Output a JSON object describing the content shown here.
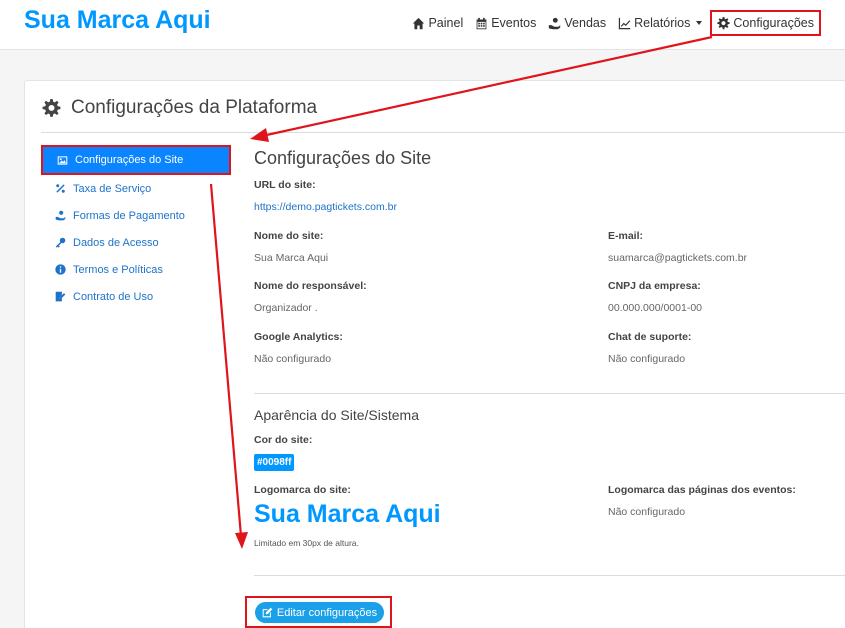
{
  "brand": "Sua Marca Aqui",
  "nav": {
    "items": [
      {
        "label": "Painel",
        "icon": "home-icon"
      },
      {
        "label": "Eventos",
        "icon": "calendar-icon"
      },
      {
        "label": "Vendas",
        "icon": "hand-money-icon"
      },
      {
        "label": "Relatórios",
        "icon": "line-chart-icon"
      },
      {
        "label": "Configurações",
        "icon": "gear-icon"
      }
    ]
  },
  "page": {
    "title": "Configurações da Plataforma"
  },
  "sidebar": {
    "items": [
      {
        "label": "Configurações do Site",
        "icon": "image-icon"
      },
      {
        "label": "Taxa de Serviço",
        "icon": "percent-icon"
      },
      {
        "label": "Formas de Pagamento",
        "icon": "hand-money-icon"
      },
      {
        "label": "Dados de Acesso",
        "icon": "key-icon"
      },
      {
        "label": "Termos e Políticas",
        "icon": "info-icon"
      },
      {
        "label": "Contrato de Uso",
        "icon": "signature-icon"
      }
    ]
  },
  "site": {
    "title": "Configurações do Site",
    "url_label": "URL do site:",
    "url_value": "https://demo.pagtickets.com.br",
    "name_label": "Nome do site:",
    "name_value": "Sua Marca Aqui",
    "email_label": "E-mail:",
    "email_value": "suamarca@pagtickets.com.br",
    "resp_label": "Nome do responsável:",
    "resp_value": "Organizador .",
    "cnpj_label": "CNPJ da empresa:",
    "cnpj_value": "00.000.000/0001-00",
    "ga_label": "Google Analytics:",
    "ga_value": "Não configurado",
    "chat_label": "Chat de suporte:",
    "chat_value": "Não configurado"
  },
  "appearance": {
    "title": "Aparência do Site/Sistema",
    "color_label": "Cor do site:",
    "color_value": "#0098ff",
    "logo_label": "Logomarca do site:",
    "logo_value": "Sua Marca Aqui",
    "logo_note": "Limitado em 30px de altura.",
    "event_logo_label": "Logomarca das páginas dos eventos:",
    "event_logo_value": "Não configurado"
  },
  "actions": {
    "edit_label": "Editar configurações"
  },
  "colors": {
    "brand": "#0098ff",
    "highlight": "#e0151b"
  }
}
